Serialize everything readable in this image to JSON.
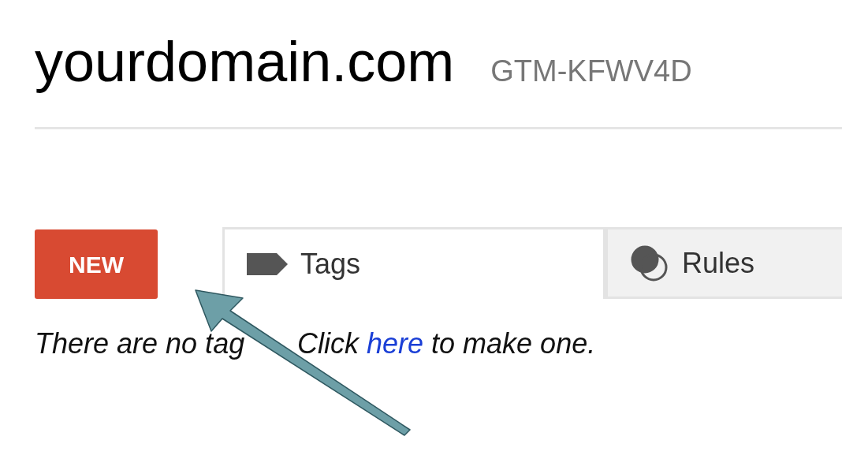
{
  "header": {
    "title": "yourdomain.com",
    "container_id": "GTM-KFWV4D"
  },
  "new_button": {
    "label": "NEW"
  },
  "tabs": [
    {
      "label": "Tags",
      "kind": "tag",
      "selected": true
    },
    {
      "label": "Rules",
      "kind": "rule",
      "selected": false
    }
  ],
  "empty_message": {
    "visible_start": "There are no tag",
    "before": "Click ",
    "link": "here",
    "after": " to make one."
  }
}
